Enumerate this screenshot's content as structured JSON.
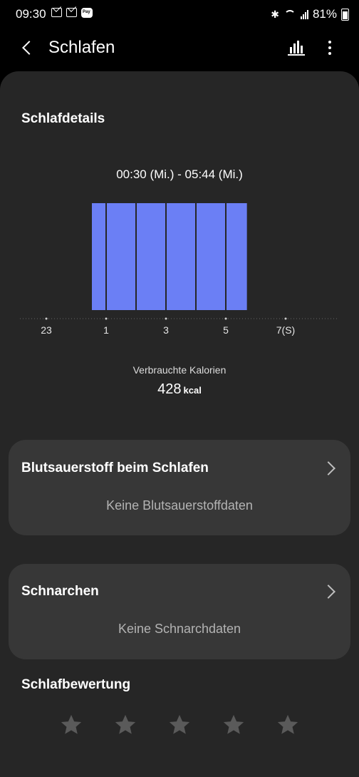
{
  "status_bar": {
    "time": "09:30",
    "battery": "81%",
    "pay_label": "Pay"
  },
  "app_bar": {
    "title": "Schlafen"
  },
  "details": {
    "title": "Schlafdetails",
    "range": "00:30 (Mi.) - 05:44 (Mi.)",
    "calories_label": "Verbrauchte Kalorien",
    "calories_value": "428",
    "calories_unit": "kcal"
  },
  "chart_data": {
    "type": "bar",
    "x_tick_labels": [
      "23",
      "1",
      "3",
      "5",
      "7(S)"
    ],
    "x_ticks": [
      23,
      25,
      27,
      29,
      31
    ],
    "xlim": [
      22,
      32
    ],
    "bars": [
      {
        "start": 24.5,
        "end": 25.0
      },
      {
        "start": 25.0,
        "end": 26.0
      },
      {
        "start": 26.0,
        "end": 27.0
      },
      {
        "start": 27.0,
        "end": 28.0
      },
      {
        "start": 28.0,
        "end": 29.0
      },
      {
        "start": 29.0,
        "end": 29.73
      }
    ],
    "bar_color": "#6b7ff5"
  },
  "blood_oxygen": {
    "title": "Blutsauerstoff beim Schlafen",
    "subtitle": "Keine Blutsauerstoffdaten"
  },
  "snoring": {
    "title": "Schnarchen",
    "subtitle": "Keine Schnarchdaten"
  },
  "rating": {
    "title": "Schlafbewertung",
    "stars": 5,
    "filled": 0
  }
}
